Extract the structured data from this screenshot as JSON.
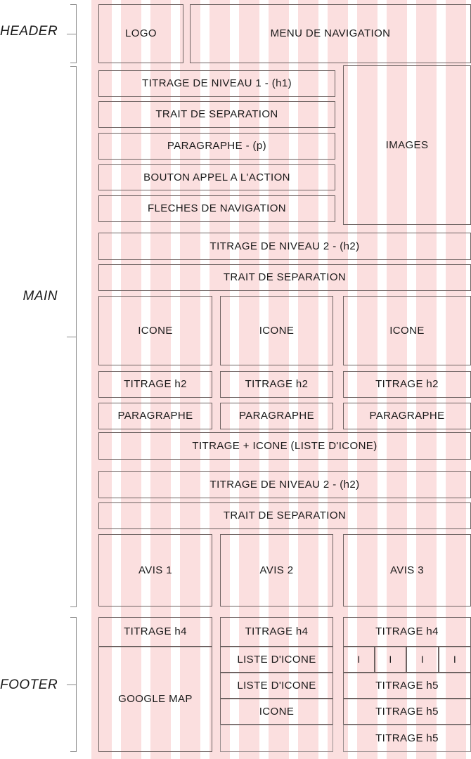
{
  "meta": {
    "title": "Wireframe de page web (FR)",
    "accent_pink": "#fbdfdf",
    "line_color": "#6e6362",
    "text_color": "#1a1a1a"
  },
  "sections": [
    {
      "key": "header",
      "label": "HEADER"
    },
    {
      "key": "main",
      "label": "MAIN"
    },
    {
      "key": "footer",
      "label": "FOOTER"
    }
  ],
  "header": {
    "label": "HEADER",
    "logo": "LOGO",
    "nav": "MENU DE NAVIGATION"
  },
  "main": {
    "label": "MAIN",
    "hero": {
      "h1": "TITRAGE DE NIVEAU 1 - (h1)",
      "separator": "TRAIT DE SEPARATION",
      "paragraph": "PARAGRAPHE - (p)",
      "cta": "BOUTON APPEL A L'ACTION",
      "arrows": "FLECHES DE NAVIGATION",
      "images": "IMAGES"
    },
    "features": {
      "h2": "TITRAGE DE NIVEAU 2 - (h2)",
      "separator": "TRAIT DE SEPARATION",
      "columns": [
        {
          "icon": "ICONE",
          "title": "TITRAGE h2",
          "paragraph": "PARAGRAPHE"
        },
        {
          "icon": "ICONE",
          "title": "TITRAGE h2",
          "paragraph": "PARAGRAPHE"
        },
        {
          "icon": "ICONE",
          "title": "TITRAGE h2",
          "paragraph": "PARAGRAPHE"
        }
      ],
      "icon_list": "TITRAGE + ICONE (LISTE D'ICONE)"
    },
    "reviews": {
      "h2": "TITRAGE DE NIVEAU 2 - (h2)",
      "separator": "TRAIT DE SEPARATION",
      "items": [
        "AVIS 1",
        "AVIS 2",
        "AVIS 3"
      ]
    }
  },
  "footer": {
    "label": "FOOTER",
    "col1": {
      "title": "TITRAGE h4",
      "map": "GOOGLE MAP"
    },
    "col2": {
      "title": "TITRAGE h4",
      "rows": [
        "LISTE D'ICONE",
        "LISTE D'ICONE",
        "ICONE",
        ""
      ]
    },
    "col3": {
      "title": "TITRAGE h4",
      "social": [
        "I",
        "I",
        "I",
        "I"
      ],
      "rows": [
        "TITRAGE h5",
        "TITRAGE h5",
        "TITRAGE h5"
      ]
    }
  }
}
